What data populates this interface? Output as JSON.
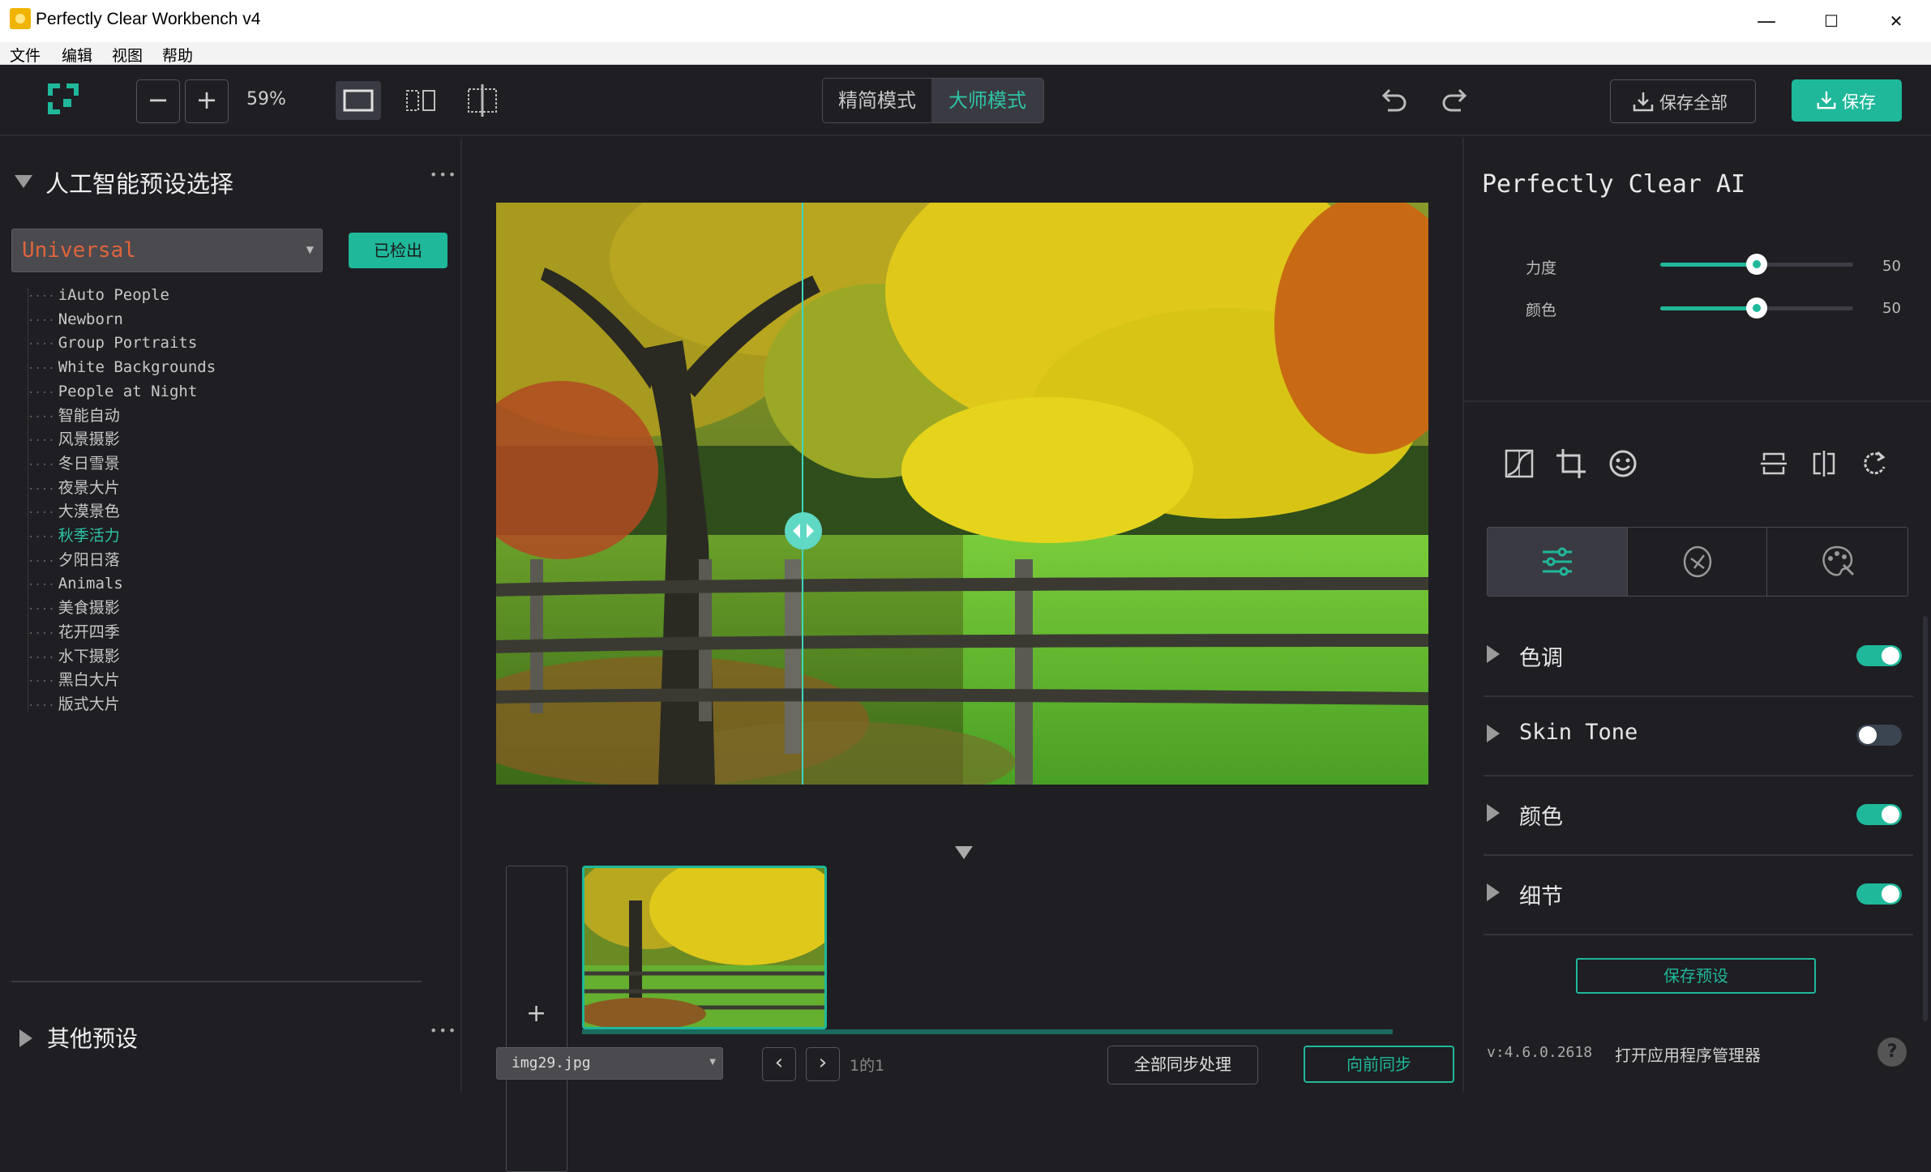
{
  "window": {
    "title": "Perfectly Clear Workbench v4",
    "minimize": "—",
    "maximize": "☐",
    "close": "✕"
  },
  "menu": [
    "文件",
    "编辑",
    "视图",
    "帮助"
  ],
  "toolbar": {
    "zoom": "59%",
    "mode_simple": "精简模式",
    "mode_master": "大师模式",
    "save_all": "保存全部",
    "save": "保存",
    "zoom_out": "−",
    "zoom_in": "+"
  },
  "left": {
    "ai_section_title": "人工智能预设选择",
    "preset_dropdown": "Universal",
    "detected_button": "已检出",
    "presets": [
      "iAuto People",
      "Newborn",
      "Group Portraits",
      "White Backgrounds",
      "People at Night",
      "智能自动",
      "风景摄影",
      "冬日雪景",
      "夜景大片",
      "大漠景色",
      "秋季活力",
      "夕阳日落",
      "Animals",
      "美食摄影",
      "花开四季",
      "水下摄影",
      "黑白大片",
      "版式大片"
    ],
    "active_preset": "秋季活力",
    "other_section_title": "其他预设",
    "more": "•••"
  },
  "center": {
    "add_button": "+",
    "file_select": "img29.jpg",
    "page_counter": "1的1",
    "sync_all": "全部同步处理",
    "sync_forward": "向前同步",
    "prev": "‹",
    "next": "›"
  },
  "right": {
    "ai_title": "Perfectly Clear AI",
    "sliders": [
      {
        "label": "力度",
        "value": 50
      },
      {
        "label": "颜色",
        "value": 50
      }
    ],
    "sections": [
      {
        "label": "色调",
        "enabled": true
      },
      {
        "label": "Skin Tone",
        "enabled": false
      },
      {
        "label": "颜色",
        "enabled": true
      },
      {
        "label": "细节",
        "enabled": true
      }
    ],
    "save_preset": "保存预设",
    "version": "v:4.6.0.2618",
    "open_manager": "打开应用程序管理器",
    "help": "?"
  },
  "colors": {
    "accent": "#1fb89a",
    "background": "#1e1e23",
    "active_text": "#2ec4a5"
  }
}
